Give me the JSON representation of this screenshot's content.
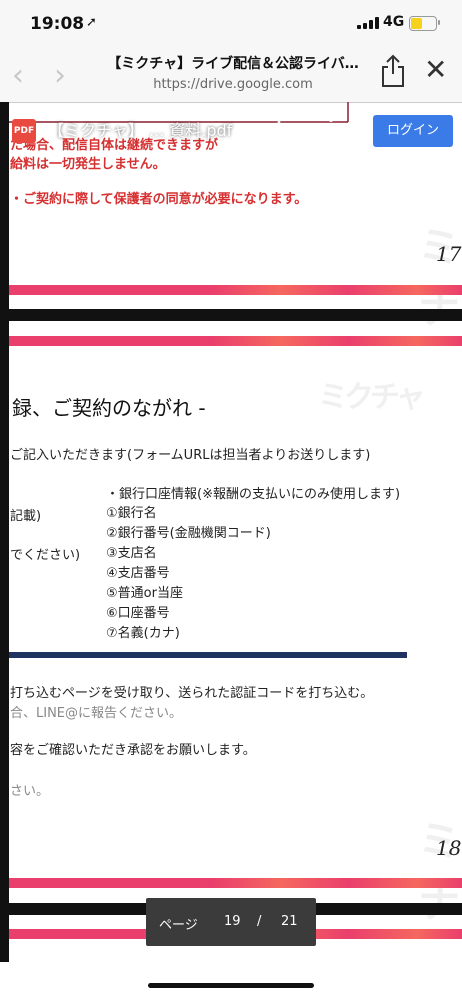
{
  "status_bar": {
    "time": "19:08",
    "location_icon": "location-arrow-icon",
    "network": "4G",
    "battery_color": "#f6d21d"
  },
  "browser": {
    "title": "【ミクチャ】ライブ配信＆公認ライバ…",
    "url": "https://drive.google.com",
    "back_icon": "chevron-left-icon",
    "forward_icon": "chevron-right-icon",
    "share_icon": "share-icon",
    "close_icon": "close-icon",
    "close_glyph": "✕"
  },
  "pdf_bar": {
    "icon_label": "PDF",
    "file_name": "【ミクチャ】 ... 資料.pdf",
    "login_label": "ログイン",
    "login_color": "#3b7be8"
  },
  "page17": {
    "red_lines": [
      "た場合、配信自体は継続できますが",
      "給料は一切発生しません。",
      "・ご契約に際して保護者の同意が必要になります。"
    ],
    "page_number": "17"
  },
  "page18": {
    "heading": "録、ご契約のながれ -",
    "intro": "ご記入いただきます(フォームURLは担当者よりお送りします)",
    "bank_title": "・銀行口座情報(※報酬の支払いにのみ使用します)",
    "left_notes": [
      "記載)",
      "でください)"
    ],
    "bank_items": [
      "①銀行名",
      "②銀行番号(金融機関コード)",
      "③支店名",
      "④支店番号",
      "⑤普通or当座",
      "⑥口座番号",
      "⑦名義(カナ)"
    ],
    "step_lines": [
      "打ち込むページを受け取り、送られた認証コードを打ち込む。",
      "合、LINE@に報告ください。",
      "容をご確認いただき承認をお願いします。",
      "さい。"
    ],
    "page_number": "18"
  },
  "page_indicator": {
    "label": "ページ",
    "current": "19",
    "separator": "/",
    "total": "21"
  },
  "colors": {
    "accent_pink": "#ea3f6c",
    "warning_red": "#d63030",
    "navy": "#1f3260"
  }
}
